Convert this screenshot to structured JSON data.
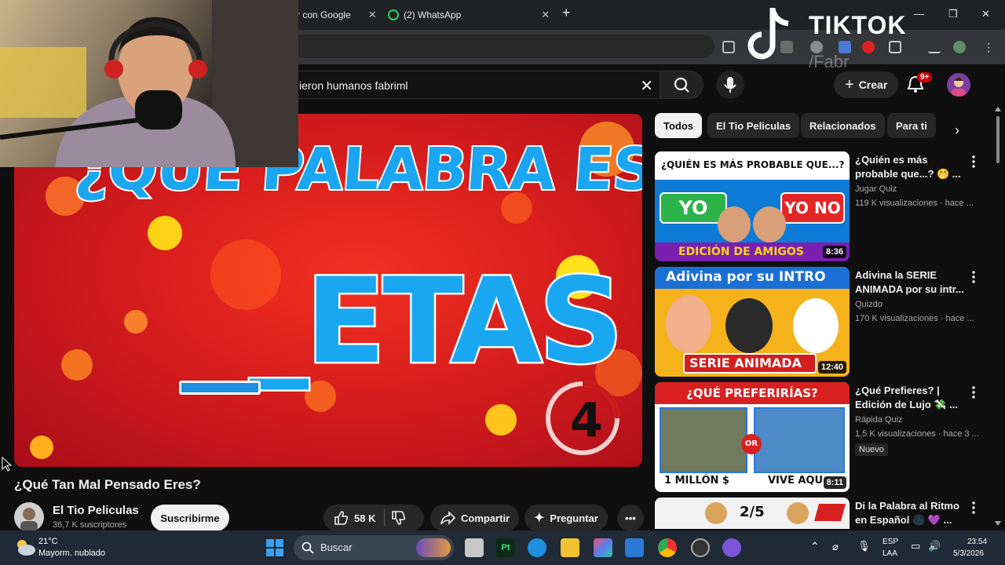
{
  "browser": {
    "tabs": [
      {
        "label": "r con Google"
      },
      {
        "label": "(2) WhatsApp"
      }
    ]
  },
  "youtube": {
    "search": {
      "query": "ieron humanos fabriml"
    },
    "create_label": "Crear",
    "notification_badge": "9+"
  },
  "tiktok": {
    "brand": "TIKTOK",
    "user": "/Fabr"
  },
  "player": {
    "thumbnail_title": "¿QUE PALABRA ES ?",
    "thumbnail_word": "_ETAS",
    "timer": "4"
  },
  "video": {
    "title": "¿Qué Tan Mal Pensado Eres?",
    "channel": "El Tio Peliculas",
    "subscribers": "36,7 K suscriptores",
    "subscribe_label": "Suscribirme",
    "likes": "58 K",
    "share_label": "Compartir",
    "ask_label": "Preguntar"
  },
  "chips": [
    "Todos",
    "El Tio Peliculas",
    "Relacionados",
    "Para ti"
  ],
  "recommendations": [
    {
      "title": "¿Quién es más probable que...? 🤭 ...",
      "channel": "Jugar Quiz",
      "meta": "119 K visualizaciones · hace ...",
      "duration": "8:36",
      "thumb_top": "¿QUIÉN ES MÁS PROBABLE QUE...?",
      "thumb_left": "YO",
      "thumb_right": "YO NO",
      "thumb_bottom": "EDICIÓN DE AMIGOS"
    },
    {
      "title": "Adivina la SERIE ANIMADA por su intr...",
      "channel": "Quizdo",
      "meta": "170 K visualizaciones · hace ...",
      "duration": "12:40",
      "thumb_top": "Adivina por su INTRO",
      "thumb_bottom": "SERIE ANIMADA"
    },
    {
      "title": "¿Qué Prefieres? | Edición de Lujo 💸 ...",
      "channel": "Rápida Quiz",
      "meta": "1,5 K visualizaciones · hace 3 ...",
      "duration": "8:11",
      "new_label": "Nuevo",
      "thumb_top": "¿QUÉ PREFERIRÍAS?",
      "thumb_left": "1 MILLÓN $",
      "thumb_or": "OR",
      "thumb_right": "VIVE AQU"
    },
    {
      "title": "Di la Palabra al Ritmo en Español 🌑 💜 ...",
      "thumb_counter": "2/5"
    }
  ],
  "taskbar": {
    "weather_temp": "21°C",
    "weather_desc": "Mayorm. nublado",
    "search_label": "Buscar",
    "lang_top": "ESP",
    "lang_bottom": "LAA",
    "time": "23:54",
    "date": "5/3/2026"
  },
  "colors": {
    "yt_bg": "#0f0f0f",
    "accent_red": "#cc0000",
    "thumb_blue": "#19a7f2"
  }
}
